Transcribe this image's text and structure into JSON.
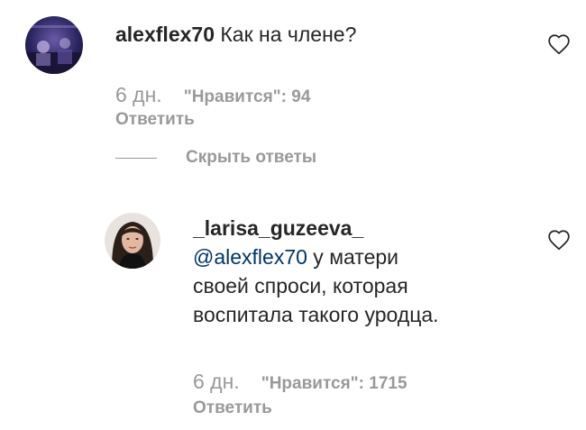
{
  "comments": [
    {
      "username": "alexflex70",
      "text": "Как на члене?",
      "age": "6 дн.",
      "likes": "\"Нравится\": 94",
      "reply_label": "Ответить"
    }
  ],
  "thread": {
    "hide_replies_label": "Скрыть ответы"
  },
  "replies": [
    {
      "username": "_larisa_guzeeva_",
      "mention": "@alexflex70",
      "text_line1": " у матери",
      "text_line2": "своей спроси, которая",
      "text_line3": "воспитала такого уродца.",
      "age": "6 дн.",
      "likes": "\"Нравится\": 1715",
      "reply_label": "Ответить"
    }
  ],
  "colors": {
    "text": "#262626",
    "muted": "#999999",
    "mention": "#003569"
  },
  "icons": {
    "like": "heart-outline-icon"
  }
}
